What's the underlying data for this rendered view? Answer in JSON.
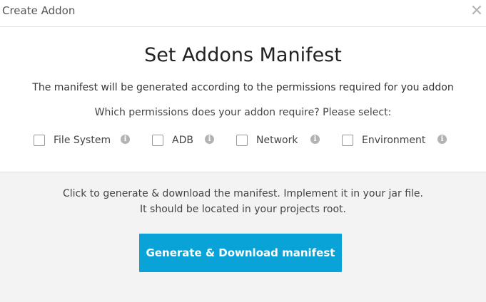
{
  "header": {
    "title": "Create Addon",
    "close_glyph": "✕"
  },
  "main": {
    "title": "Set Addons Manifest",
    "description": "The manifest will be generated according to the permissions required for you addon",
    "question": "Which permissions does your addon require? Please select:"
  },
  "permissions": [
    {
      "label": "File System",
      "checked": false,
      "icon": "info-icon"
    },
    {
      "label": "ADB",
      "checked": false,
      "icon": "info-icon"
    },
    {
      "label": "Network",
      "checked": false,
      "icon": "info-icon"
    },
    {
      "label": "Environment",
      "checked": false,
      "icon": "info-icon"
    }
  ],
  "footer": {
    "instruction_line1": "Click to generate & download the manifest. Implement it in your jar file.",
    "instruction_line2": "It should be located in your projects root.",
    "button_label": "Generate & Download manifest"
  },
  "colors": {
    "accent": "#0aa3d8",
    "footer_bg": "#f3f3f3",
    "info_icon": "#b3b3b3"
  }
}
